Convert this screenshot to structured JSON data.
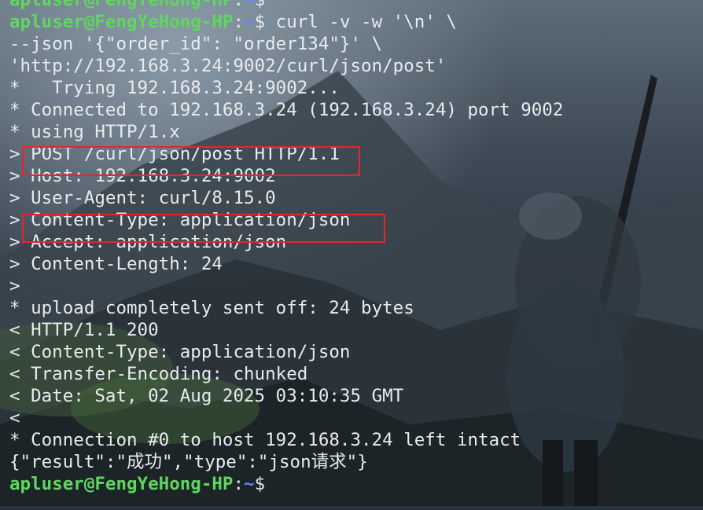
{
  "prompt": {
    "user_host": "apluser@FengYeHong-HP",
    "colon": ":",
    "path": "~",
    "dollar": "$"
  },
  "command": {
    "line1": " curl -v -w '\\n' \\",
    "line2": "--json '{\"order_id\": \"order134\"}' \\",
    "line3": "'http://192.168.3.24:9002/curl/json/post'"
  },
  "output": [
    "*   Trying 192.168.3.24:9002...",
    "* Connected to 192.168.3.24 (192.168.3.24) port 9002",
    "* using HTTP/1.x",
    "> POST /curl/json/post HTTP/1.1",
    "> Host: 192.168.3.24:9002",
    "> User-Agent: curl/8.15.0",
    "> Content-Type: application/json",
    "> Accept: application/json",
    "> Content-Length: 24",
    ">",
    "* upload completely sent off: 24 bytes",
    "< HTTP/1.1 200",
    "< Content-Type: application/json",
    "< Transfer-Encoding: chunked",
    "< Date: Sat, 02 Aug 2025 03:10:35 GMT",
    "<",
    "* Connection #0 to host 192.168.3.24 left intact",
    "{\"result\":\"成功\",\"type\":\"json请求\"}"
  ],
  "colors": {
    "prompt_user": "#5fd75f",
    "prompt_path": "#5f87ff",
    "text": "#e8ebee",
    "highlight_box": "#e8242c"
  }
}
